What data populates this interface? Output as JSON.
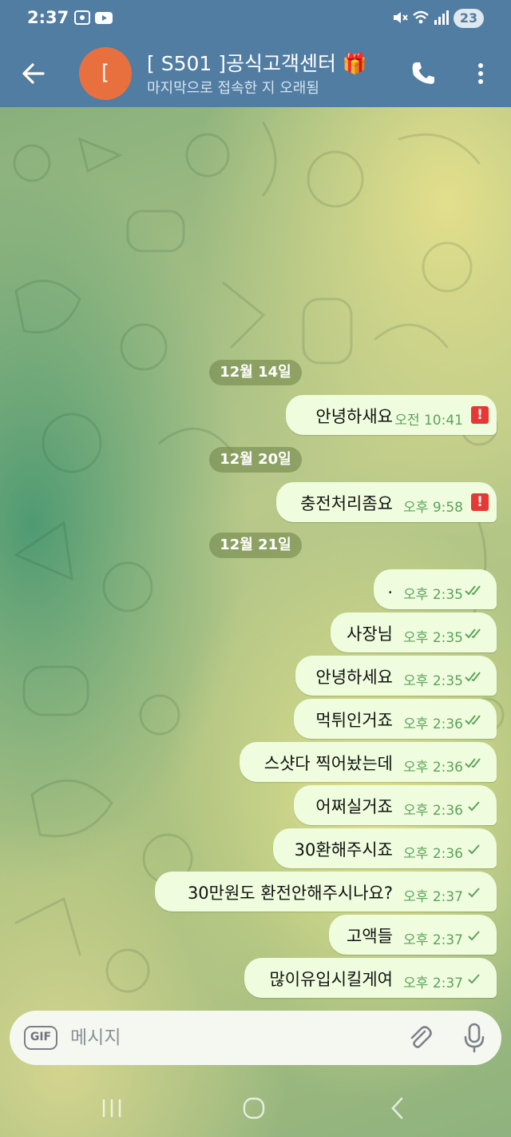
{
  "status_bar": {
    "time": "2:37",
    "battery": "23",
    "icons": [
      "screen-record-icon",
      "youtube-icon",
      "mute-icon",
      "wifi-icon",
      "signal-icon",
      "battery-icon"
    ]
  },
  "header": {
    "avatar_letter": "[",
    "avatar_color": "#e8703f",
    "title": "[ S501 ]공식고객센터 🎁",
    "subtitle": "마지막으로 접속한 지 오래됨",
    "bar_color": "#517da2"
  },
  "chat": {
    "dates": [
      "12월 14일",
      "12월 20일",
      "12월 21일"
    ],
    "messages": [
      {
        "text": "안녕하새요",
        "time": "오전 10:41",
        "status": "failed"
      },
      {
        "text": "충전처리좀요",
        "time": "오후 9:58",
        "status": "failed"
      },
      {
        "text": ".",
        "time": "오후 2:35",
        "status": "read"
      },
      {
        "text": "사장님",
        "time": "오후 2:35",
        "status": "read"
      },
      {
        "text": "안녕하세요",
        "time": "오후 2:35",
        "status": "read"
      },
      {
        "text": "먹튀인거죠",
        "time": "오후 2:36",
        "status": "read"
      },
      {
        "text": "스샷다 찍어놨는데",
        "time": "오후 2:36",
        "status": "read"
      },
      {
        "text": "어쩌실거죠",
        "time": "오후 2:36",
        "status": "sent"
      },
      {
        "text": "30환해주시죠",
        "time": "오후 2:36",
        "status": "sent"
      },
      {
        "text": "30만원도 환전안해주시나요?",
        "time": "오후 2:37",
        "status": "sent"
      },
      {
        "text": "고액들",
        "time": "오후 2:37",
        "status": "sent"
      },
      {
        "text": "많이유입시킬게여",
        "time": "오후 2:37",
        "status": "sent"
      }
    ],
    "failed_mark": "!",
    "bubble_color": "#effdde",
    "time_color": "#5ea25c"
  },
  "input": {
    "gif_label": "GIF",
    "placeholder": "메시지"
  }
}
